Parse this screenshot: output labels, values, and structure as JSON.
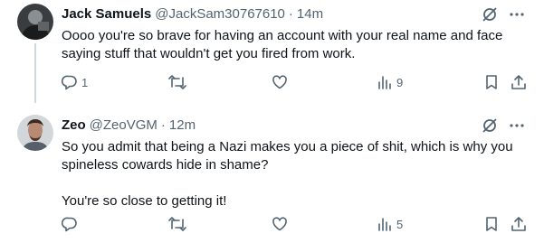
{
  "tweets": [
    {
      "name": "Jack Samuels",
      "handle": "@JackSam30767610",
      "separator": "·",
      "time": "14m",
      "text": "Oooo you're so brave for having an account with your real name and face saying stuff that wouldn't get you fired from work.",
      "reply_count": "1",
      "view_count": "9"
    },
    {
      "name": "Zeo",
      "handle": "@ZeoVGM",
      "separator": "·",
      "time": "12m",
      "text": "So you admit that being a Nazi makes you a piece of shit, which is why you spineless cowards hide in shame?\n\nYou're so close to getting it!",
      "reply_count": "",
      "view_count": "5"
    }
  ],
  "colors": {
    "text_primary": "#0f1419",
    "text_secondary": "#536471",
    "thread_line": "#cfd9de"
  },
  "icons": [
    "grok-icon",
    "more-icon",
    "reply-icon",
    "retweet-icon",
    "like-icon",
    "views-icon",
    "bookmark-icon",
    "share-icon"
  ]
}
